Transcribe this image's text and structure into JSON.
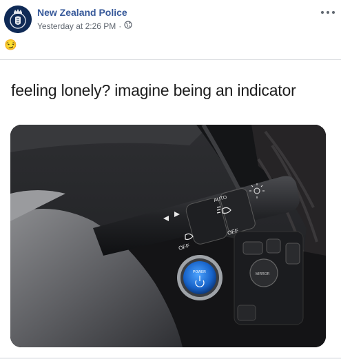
{
  "post": {
    "page_name": "New Zealand Police",
    "timestamp": "Yesterday at 2:26 PM",
    "separator": "·",
    "privacy_icon": "globe-icon",
    "menu_icon": "more-options-icon",
    "reaction_emoji": "😏",
    "caption": "feeling lonely? imagine being an indicator",
    "brand_color": "#365899"
  },
  "photo": {
    "stalk_labels": {
      "auto": "AUTO",
      "off_left": "OFF",
      "off_right": "OFF"
    },
    "buttons": {
      "power": "POWER",
      "mirror": "MIRROR"
    }
  }
}
